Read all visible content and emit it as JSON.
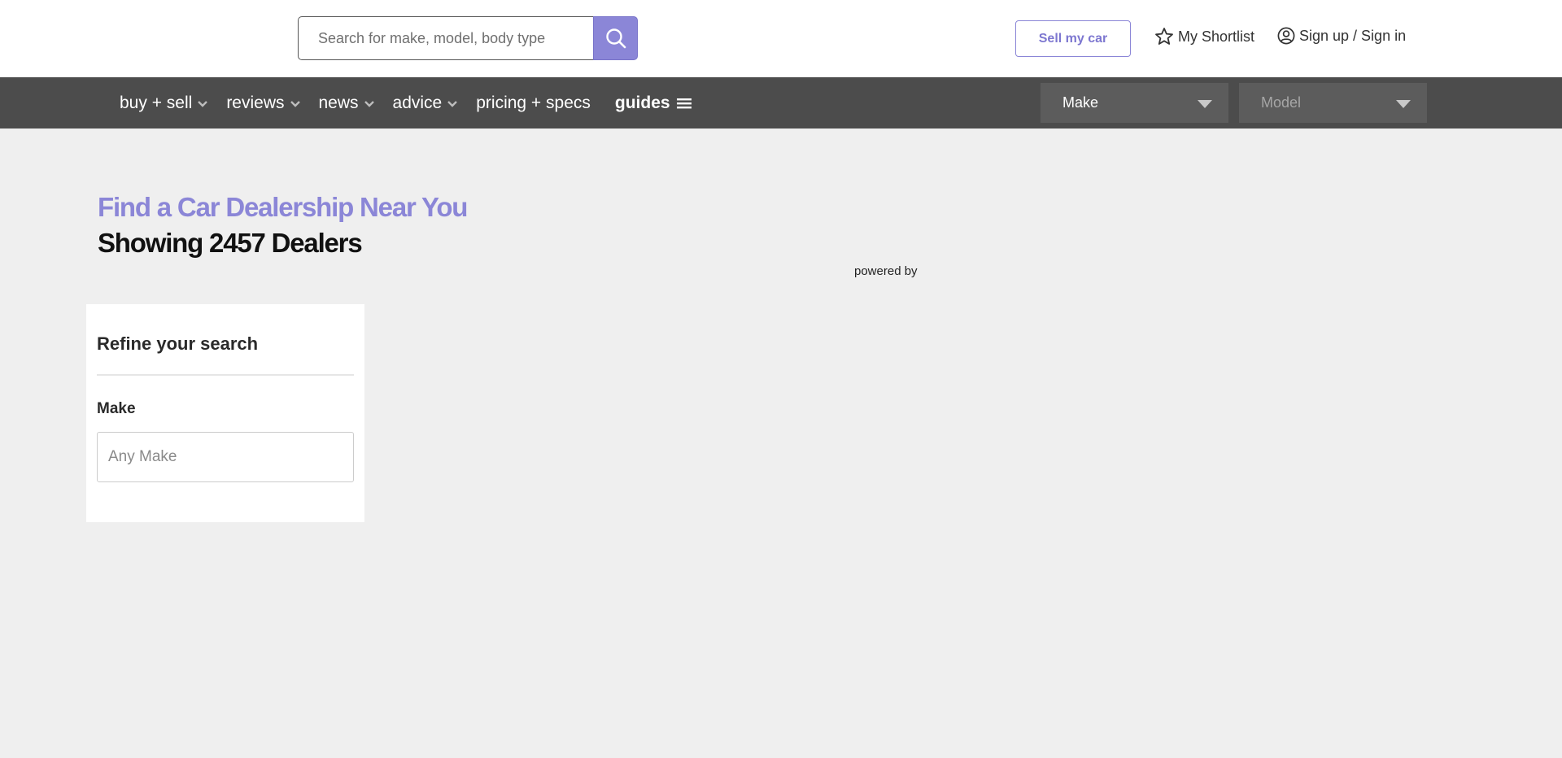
{
  "header": {
    "search_placeholder": "Search for make, model, body type",
    "sell_label": "Sell my car",
    "shortlist_label": "My Shortlist",
    "signin_label": "Sign up / Sign in"
  },
  "nav": {
    "items": [
      {
        "label": "buy + sell"
      },
      {
        "label": "reviews"
      },
      {
        "label": "news"
      },
      {
        "label": "advice"
      },
      {
        "label": "pricing + specs"
      },
      {
        "label": "guides"
      }
    ],
    "make_select": "Make",
    "model_select": "Model"
  },
  "main": {
    "title": "Find a Car Dealership Near You",
    "dealer_count": "Showing 2457 Dealers",
    "powered_by": "powered by"
  },
  "refine": {
    "title": "Refine your search",
    "make_label": "Make",
    "make_placeholder": "Any Make"
  },
  "colors": {
    "accent": "#8b86d7",
    "nav_bg": "#4c4c4c",
    "page_bg": "#efefef"
  },
  "icons": {
    "search": "search-icon",
    "shortlist": "star-icon",
    "signin": "user-circle-icon",
    "dropdown": "chevron-down-icon",
    "guides": "hamburger-menu-icon"
  }
}
